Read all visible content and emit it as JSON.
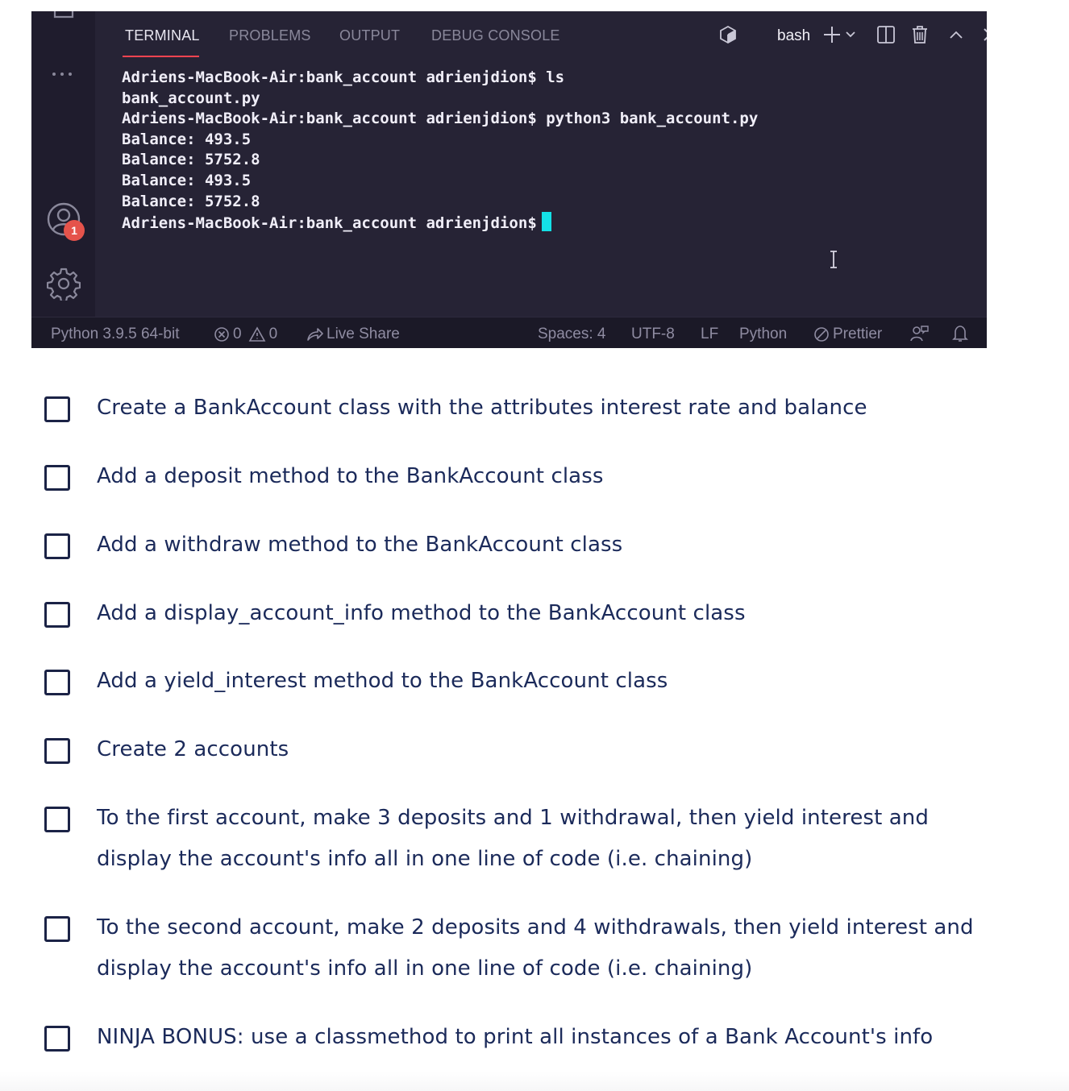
{
  "panel": {
    "tabs": [
      {
        "label": "TERMINAL",
        "active": true
      },
      {
        "label": "PROBLEMS",
        "active": false
      },
      {
        "label": "OUTPUT",
        "active": false
      },
      {
        "label": "DEBUG CONSOLE",
        "active": false
      }
    ],
    "shell_label": "bash",
    "toolbar_icons": [
      "terminal-shell-icon",
      "new-terminal-plus-icon",
      "chevron-down-icon",
      "split-terminal-icon",
      "trash-icon",
      "maximize-chevron-up-icon",
      "close-icon"
    ]
  },
  "activity_bar": {
    "icons": [
      "explorer-partial-icon",
      "more-ellipsis-icon",
      "accounts-icon",
      "settings-gear-icon"
    ],
    "accounts_badge": "1"
  },
  "terminal": {
    "lines": [
      "Adriens-MacBook-Air:bank_account adrienjdion$ ls",
      "bank_account.py",
      "Adriens-MacBook-Air:bank_account adrienjdion$ python3 bank_account.py",
      "Balance: 493.5",
      "Balance: 5752.8",
      "Balance: 493.5",
      "Balance: 5752.8",
      "Adriens-MacBook-Air:bank_account adrienjdion$"
    ],
    "cursor_color": "#14e0e6"
  },
  "status_bar": {
    "interpreter": "Python 3.9.5 64-bit",
    "errors": "0",
    "warnings": "0",
    "live_share": "Live Share",
    "spaces": "Spaces: 4",
    "encoding": "UTF-8",
    "eol": "LF",
    "language": "Python",
    "formatter": "Prettier"
  },
  "colors": {
    "editor_bg": "#262335",
    "activity_bg": "#1f1c2d",
    "active_tab_underline": "#fe4450",
    "badge": "#e5534b",
    "task_text": "#1b2a5a",
    "checkbox_border": "#1b2346"
  },
  "tasks": [
    {
      "text": "Create a BankAccount class with the attributes interest rate and balance",
      "checked": false
    },
    {
      "text": "Add a deposit method to the BankAccount class",
      "checked": false
    },
    {
      "text": "Add a withdraw method to the BankAccount class",
      "checked": false
    },
    {
      "text": "Add a display_account_info method to the BankAccount class",
      "checked": false
    },
    {
      "text": "Add a yield_interest method to the BankAccount class",
      "checked": false
    },
    {
      "text": "Create 2 accounts",
      "checked": false
    },
    {
      "text": "To the first account, make 3 deposits and 1 withdrawal, then yield interest and display the account's info all in one line of code (i.e. chaining)",
      "checked": false
    },
    {
      "text": "To the second account, make 2 deposits and 4 withdrawals, then yield interest and display the account's info all in one line of code (i.e. chaining)",
      "checked": false
    },
    {
      "text": "NINJA BONUS: use a classmethod to print all instances of a Bank Account's info",
      "checked": false
    }
  ]
}
